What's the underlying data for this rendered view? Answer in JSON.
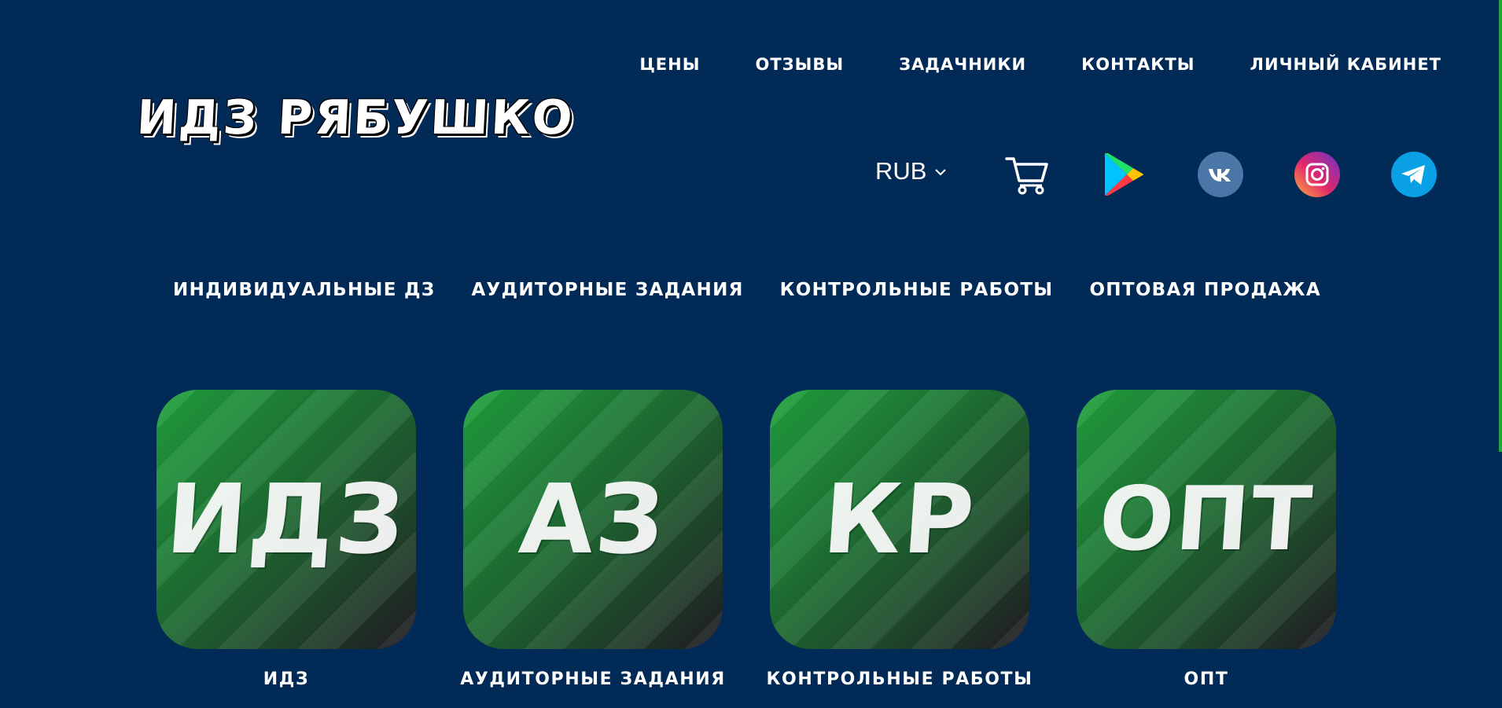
{
  "top_nav": [
    "ЦЕНЫ",
    "ОТЗЫВЫ",
    "ЗАДАЧНИКИ",
    "КОНТАКТЫ",
    "ЛИЧНЫЙ КАБИНЕТ"
  ],
  "logo": "ИДЗ РЯБУШКО",
  "currency": {
    "value": "RUB",
    "icon": "chevron-down-icon"
  },
  "icons": [
    "cart-icon",
    "google-play-icon",
    "vk-icon",
    "instagram-icon",
    "telegram-icon"
  ],
  "sub_nav": [
    "ИНДИВИДУАЛЬНЫЕ ДЗ",
    "АУДИТОРНЫЕ ЗАДАНИЯ",
    "КОНТРОЛЬНЫЕ РАБОТЫ",
    "ОПТОВАЯ ПРОДАЖА"
  ],
  "cards": [
    {
      "tile": "ИДЗ",
      "label": "ИДЗ"
    },
    {
      "tile": "АЗ",
      "label": "АУДИТОРНЫЕ ЗАДАНИЯ"
    },
    {
      "tile": "КР",
      "label": "КОНТРОЛЬНЫЕ РАБОТЫ"
    },
    {
      "tile": "ОПТ",
      "label": "ОПТ"
    }
  ],
  "colors": {
    "background": "#012a57",
    "accent_green": "#1fa83c",
    "vk_blue": "#4a76a8",
    "telegram_blue": "#0aa0e6"
  }
}
